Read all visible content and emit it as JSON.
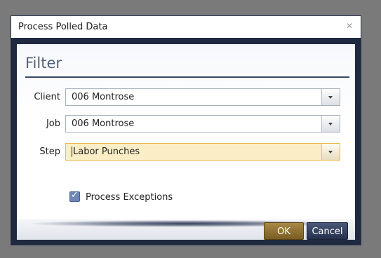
{
  "dialog": {
    "title": "Process Polled Data",
    "close_icon": "close-icon",
    "close_glyph": "✕"
  },
  "filter": {
    "heading": "Filter",
    "client": {
      "label": "Client",
      "value": "006 Montrose"
    },
    "job": {
      "label": "Job",
      "value": "006 Montrose"
    },
    "step": {
      "label": "Step",
      "value": "Labor Punches"
    },
    "process_exceptions": {
      "label": "Process Exceptions",
      "checked": true,
      "check_glyph": "✓"
    }
  },
  "buttons": {
    "ok": "OK",
    "cancel": "Cancel"
  },
  "colors": {
    "dialog_frame": "#1f2a40",
    "ok_button": "#8b6d2f",
    "cancel_button": "#2f3b58",
    "active_select": "#fbeec6"
  }
}
